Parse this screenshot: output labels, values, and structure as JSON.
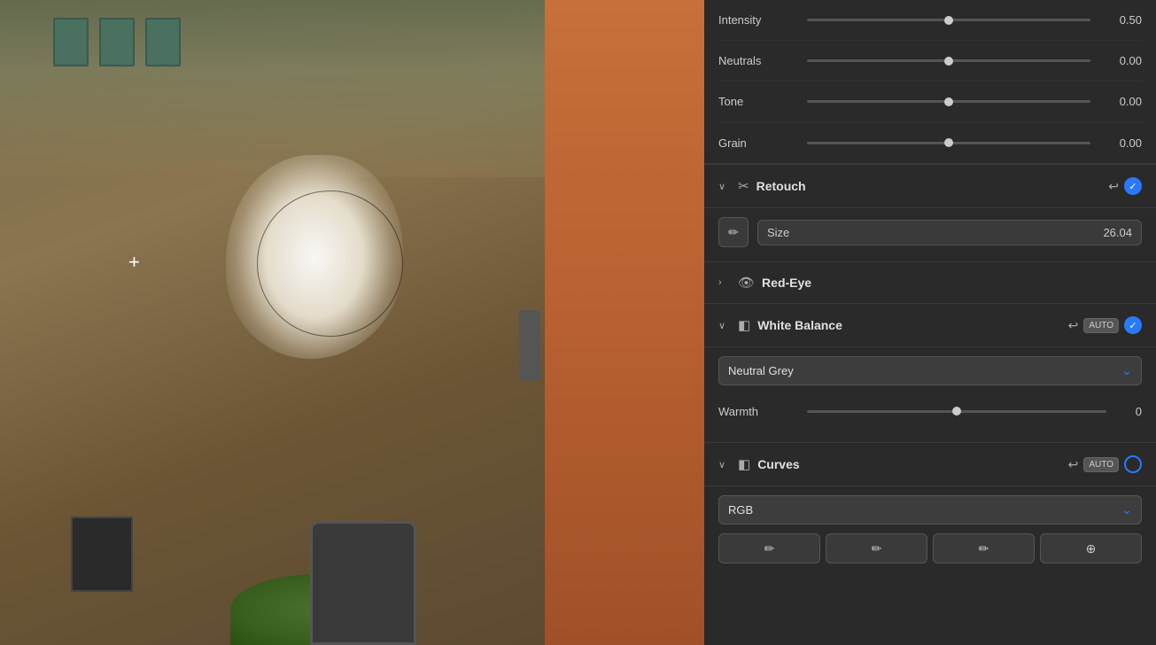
{
  "canvas": {
    "crosshair": "+"
  },
  "panel": {
    "sliders": [
      {
        "label": "Intensity",
        "value": "0.50",
        "thumbPct": 50
      },
      {
        "label": "Neutrals",
        "value": "0.00",
        "thumbPct": 50
      },
      {
        "label": "Tone",
        "value": "0.00",
        "thumbPct": 50
      },
      {
        "label": "Grain",
        "value": "0.00",
        "thumbPct": 50
      }
    ],
    "retouch": {
      "title": "Retouch",
      "chevron": "∨",
      "sizeLabel": "Size",
      "sizeValue": "26.04"
    },
    "redEye": {
      "title": "Red-Eye",
      "chevron": "›"
    },
    "whiteBalance": {
      "title": "White Balance",
      "chevron": "∨",
      "autoLabel": "AUTO",
      "dropdownValue": "Neutral Grey",
      "warmthLabel": "Warmth",
      "warmthValue": "0"
    },
    "curves": {
      "title": "Curves",
      "chevron": "∨",
      "autoLabel": "AUTO",
      "dropdownValue": "RGB",
      "tools": [
        "✏",
        "✏",
        "✏",
        "⊕"
      ]
    }
  }
}
